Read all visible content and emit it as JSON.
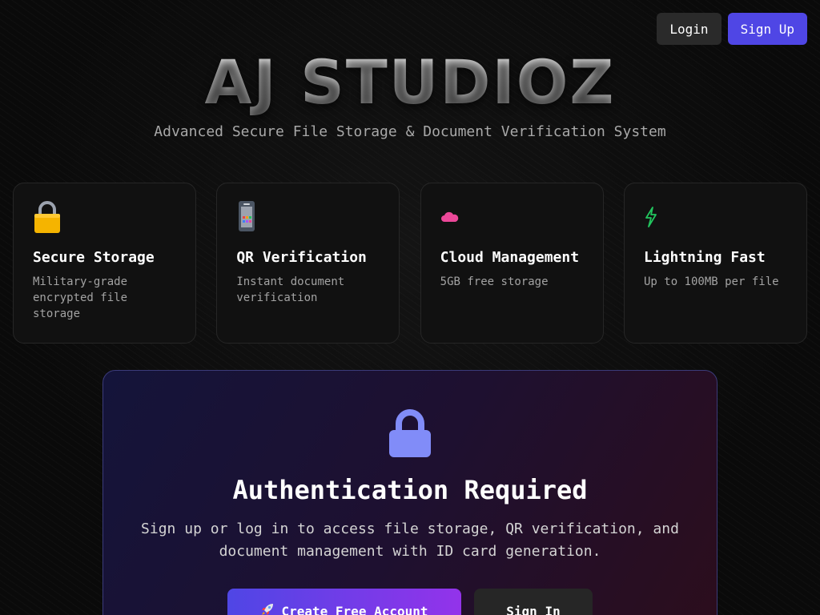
{
  "header": {
    "login_label": "Login",
    "signup_label": "Sign Up"
  },
  "hero": {
    "title": "AJ STUDIOZ",
    "subtitle": "Advanced Secure File Storage & Document Verification System"
  },
  "features": [
    {
      "icon": "padlock-icon",
      "title": "Secure Storage",
      "description": "Military-grade encrypted file storage",
      "color": "#f5b400"
    },
    {
      "icon": "mobile-phone-icon",
      "title": "QR Verification",
      "description": "Instant document verification",
      "color": "#9ca3af"
    },
    {
      "icon": "cloud-icon",
      "title": "Cloud Management",
      "description": "5GB free storage",
      "color": "#ec4899"
    },
    {
      "icon": "lightning-icon",
      "title": "Lightning Fast",
      "description": "Up to 100MB per file",
      "color": "#22c55e"
    }
  ],
  "auth": {
    "icon": "lock-icon",
    "title": "Authentication Required",
    "description": "Sign up or log in to access file storage, QR verification, and document management with ID card generation.",
    "create_label": "Create Free Account",
    "create_icon": "rocket-icon",
    "signin_label": "Sign In",
    "accent_color": "#818cf8"
  },
  "colors": {
    "background": "#0a0a0a",
    "primary": "#4f46e5",
    "secondary_gradient_end": "#9333ea"
  }
}
